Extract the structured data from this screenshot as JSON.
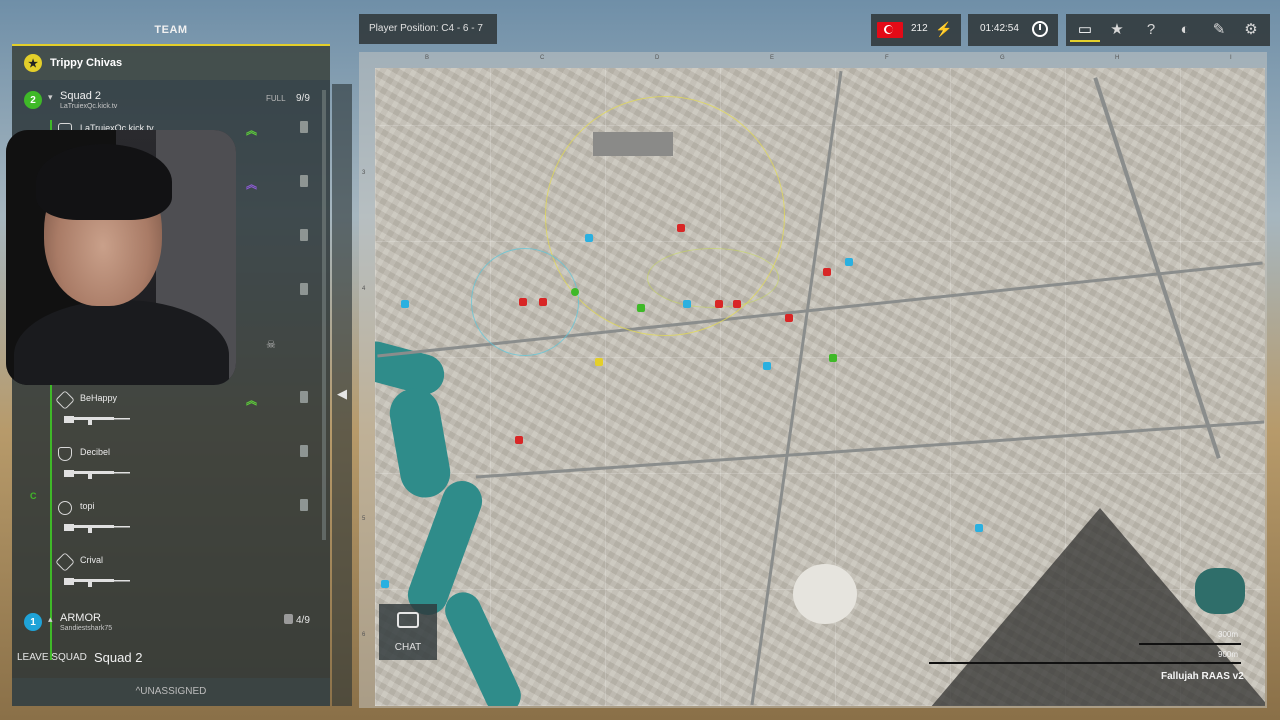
{
  "team": {
    "header": "TEAM",
    "commander": "Trippy Chivas"
  },
  "squad2": {
    "number": "2",
    "name": "Squad 2",
    "leader_sub": "LaTruiexQc.kick.tv",
    "state": "FULL",
    "count": "9/9",
    "letter": "C",
    "members": [
      {
        "name": "LaTruiexQc.kick.tv",
        "icon": "squad-leader-icon"
      },
      {
        "name": "BeHappy",
        "icon": "crewman-icon"
      },
      {
        "name": "Decibel",
        "icon": "medic-icon"
      },
      {
        "name": "topi",
        "icon": "rifleman-icon"
      },
      {
        "name": "Crival",
        "icon": "engineer-icon"
      }
    ]
  },
  "armor_squad": {
    "number": "1",
    "name": "ARMOR",
    "leader_sub": "Sandiestshark75",
    "count": "4/9"
  },
  "footer": {
    "leave_label": "LEAVE SQUAD",
    "current_squad": "Squad 2",
    "unassigned": "UNASSIGNED"
  },
  "topbar": {
    "player_position": "Player Position: C4 - 6 - 7",
    "tickets": "212",
    "timer": "01:42:54",
    "icons": [
      "chat-icon",
      "star-icon",
      "help-icon",
      "voice-help-icon",
      "tools-icon",
      "gear-icon"
    ]
  },
  "map": {
    "columns": [
      "B",
      "C",
      "D",
      "E",
      "F",
      "G",
      "H",
      "I"
    ],
    "rows": [
      "3",
      "4",
      "5",
      "6"
    ],
    "scale_small": "300m",
    "scale_large": "900m",
    "name": "Fallujah RAAS v2"
  },
  "chat": {
    "label": "CHAT"
  },
  "colors": {
    "accent": "#e4cf2a",
    "squad_green": "#3fb928",
    "armor_blue": "#1fa3d8",
    "river": "#2f8c8a"
  }
}
